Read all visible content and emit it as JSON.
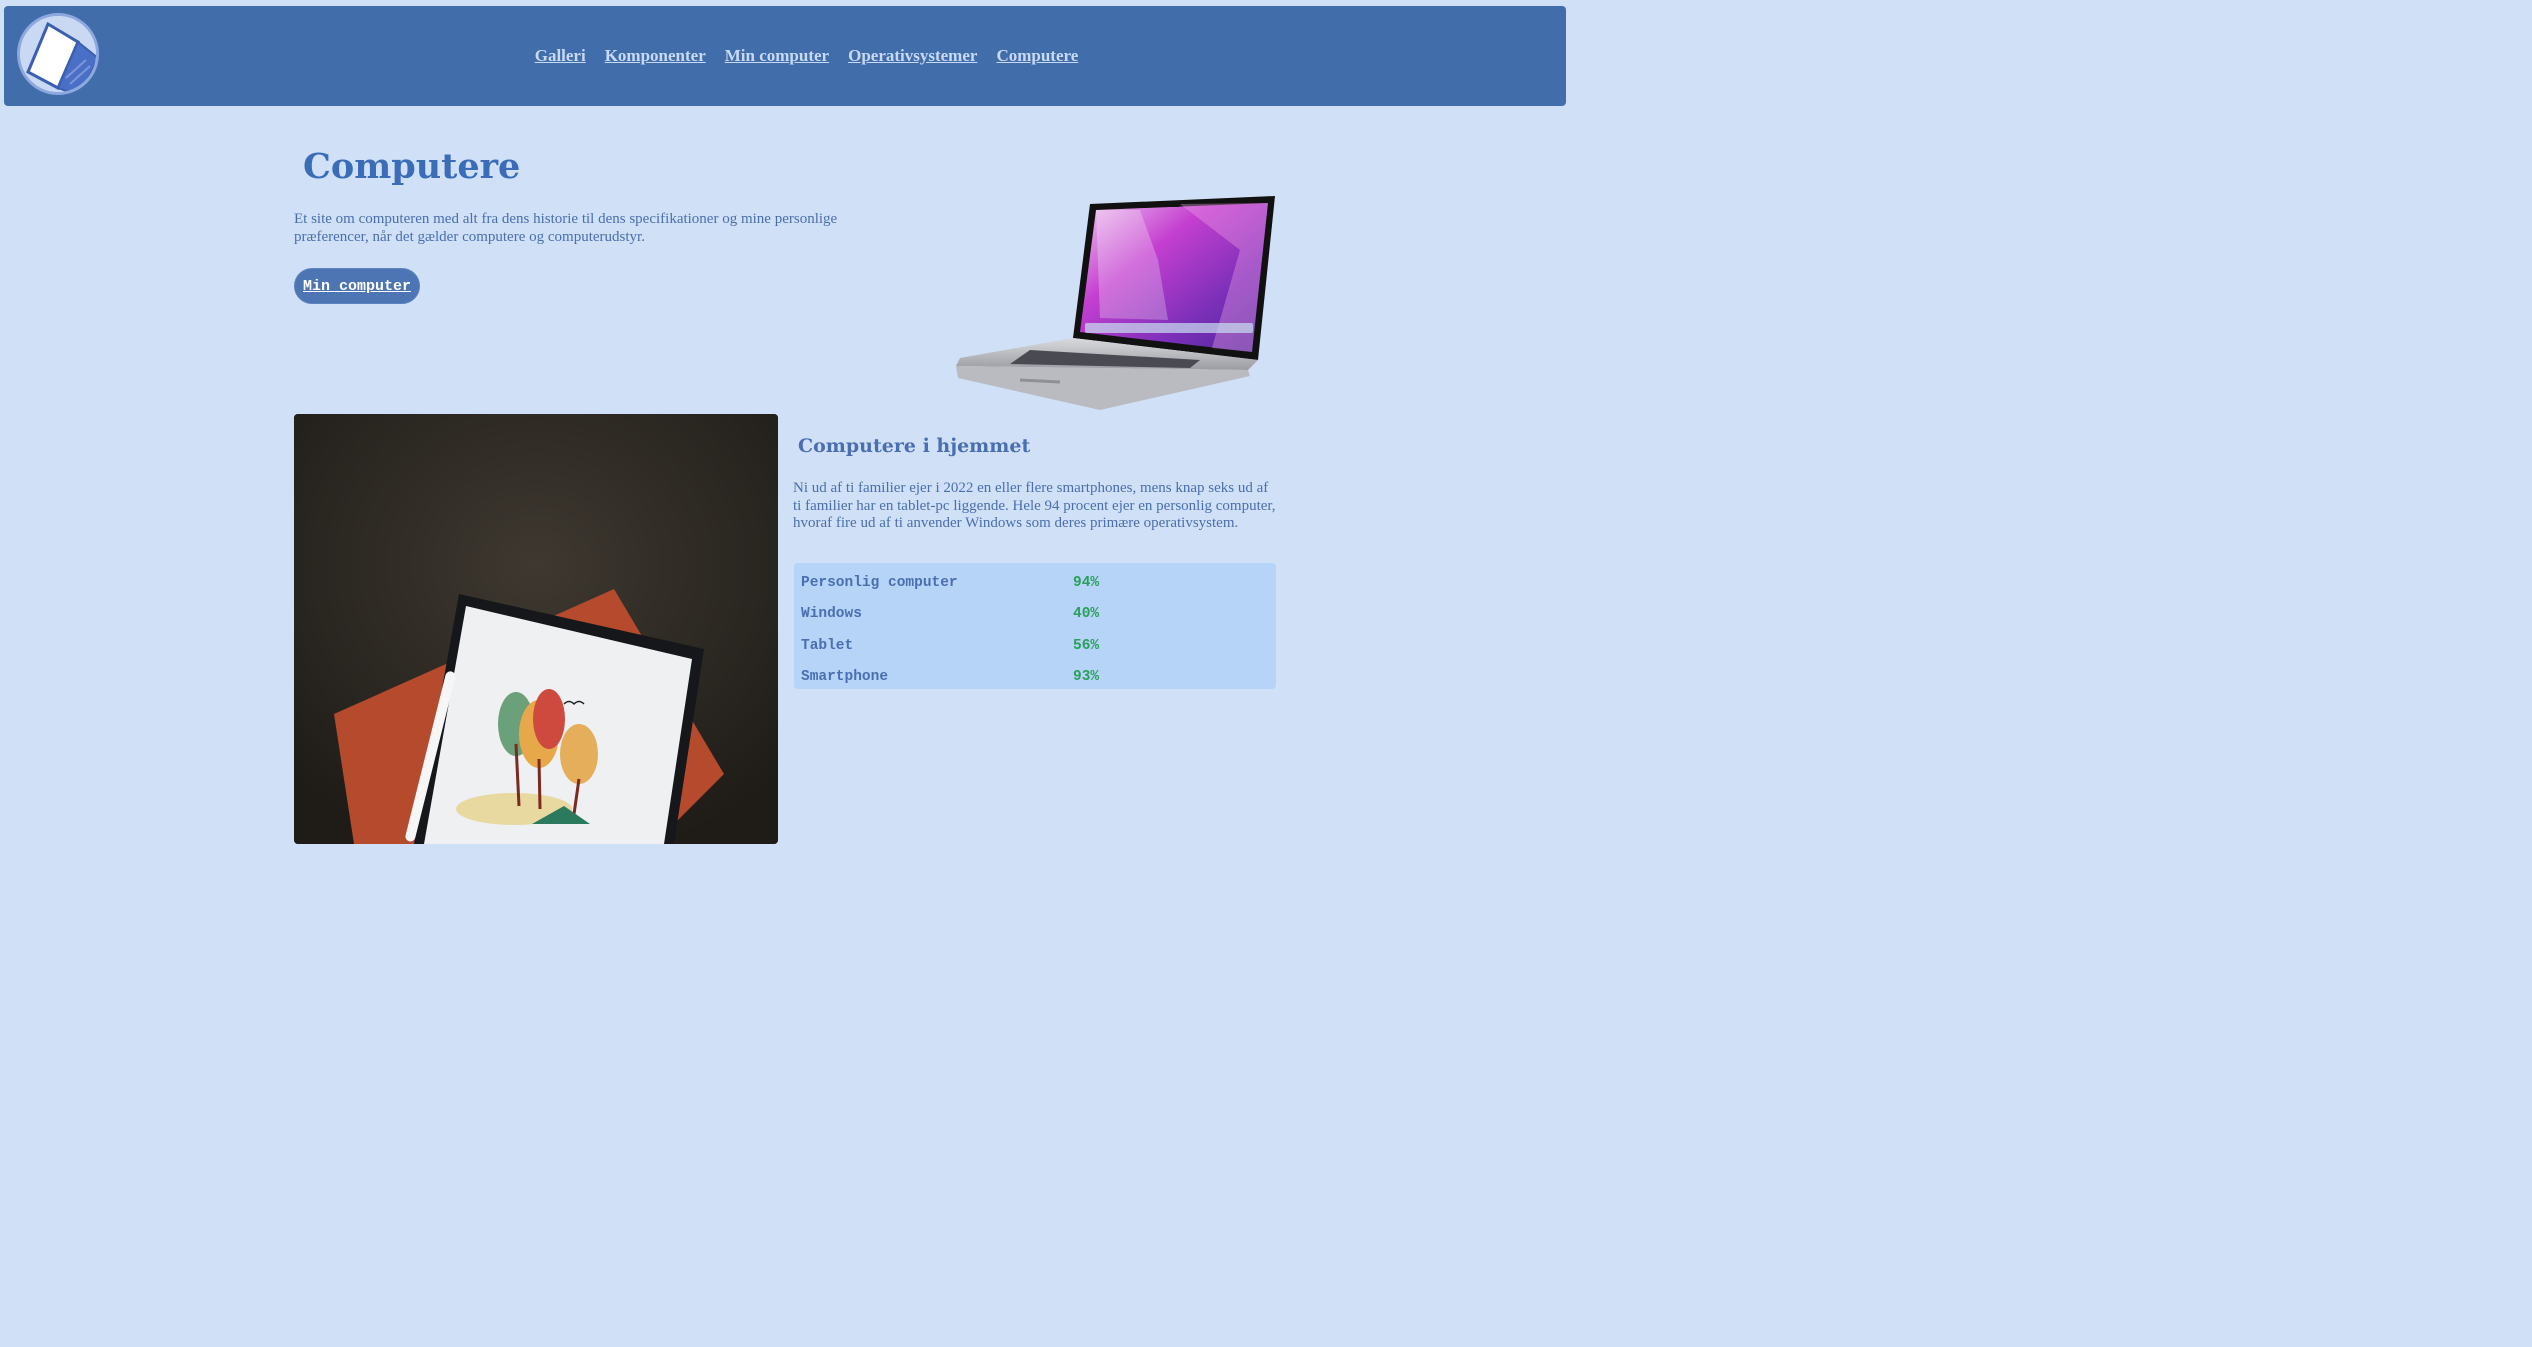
{
  "nav": {
    "items": [
      {
        "label": "Galleri"
      },
      {
        "label": "Komponenter"
      },
      {
        "label": "Min computer"
      },
      {
        "label": "Operativsystemer"
      },
      {
        "label": "Computere"
      }
    ]
  },
  "hero": {
    "title": "Computere",
    "intro": "Et site om computeren med alt fra dens historie til dens specifikationer og mine personlige præferencer, når det gælder computere og computerudstyr.",
    "button_label": "Min computer"
  },
  "home_section": {
    "heading": "Computere i hjemmet",
    "text": "Ni ud af ti familier ejer i 2022 en eller flere smartphones, mens knap seks ud af ti familier har en tablet-pc liggende. Hele 94 procent ejer en personlig computer, hvoraf fire ud af ti anvender Windows som deres primære operativsystem."
  },
  "stats": [
    {
      "label": "Personlig computer",
      "value": "94%"
    },
    {
      "label": "Windows",
      "value": "40%"
    },
    {
      "label": "Tablet",
      "value": "56%"
    },
    {
      "label": "Smartphone",
      "value": "93%"
    }
  ],
  "colors": {
    "background": "#cfe0f7",
    "navbar": "#426dab",
    "accent": "#3b6cb8",
    "stat_value": "#2aa05c"
  }
}
